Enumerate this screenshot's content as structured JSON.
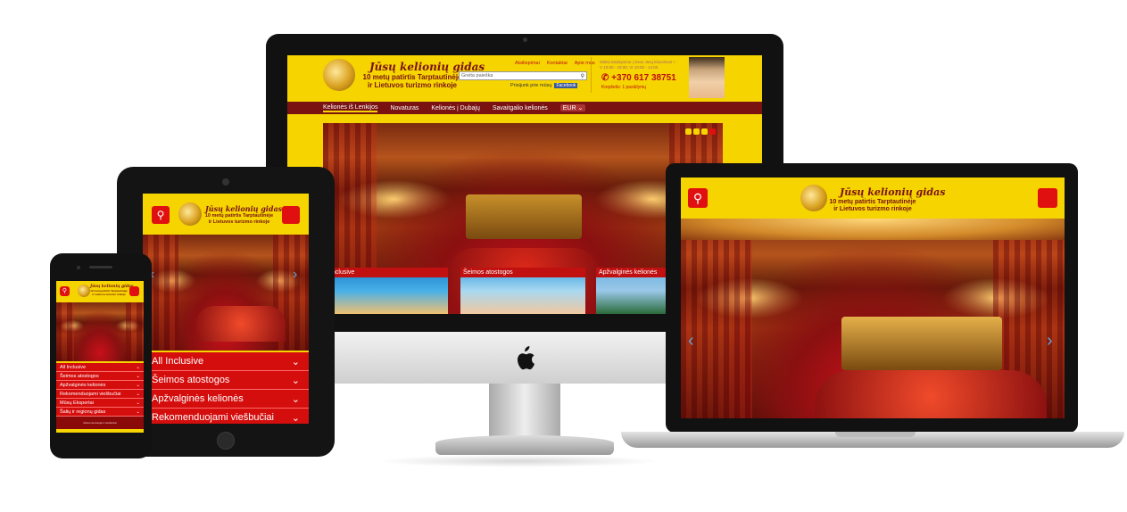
{
  "brand": {
    "title": "Jūsų kelionių gidas",
    "subtitle_line1": "10 metų patirtis Tarptautinėje",
    "subtitle_line2": "ir Lietuvos turizmo rinkoje"
  },
  "desktop": {
    "search_placeholder": "Greita paieška",
    "top_links": [
      "Atsiliepimai",
      "Kontaktai",
      "Apie mus"
    ],
    "follow_text": "Prisijunk prie mūsų",
    "fb_label": "Facebook",
    "hours_line1": "Mielai atsakysime į visus Jūsų klausimus I -",
    "hours_line2": "V 10:00 - 19:00, VI 10:00 - 14:00",
    "phone": "+370 617 38751",
    "callback": "Krepšelis: 1 pasiūlymų",
    "nav": [
      "Kelionės iš Lenkijos",
      "Novaturas",
      "Kelionės į Dubajų",
      "Savaitgalio kelionės"
    ],
    "currency": "EUR",
    "tiles": [
      "ll Inclusive",
      "Šeimos atostogos",
      "Apžvalginės kelionės"
    ]
  },
  "tablet": {
    "menu": [
      "All Inclusive",
      "Šeimos atostogos",
      "Apžvalginės kelionės",
      "Rekomenduojami viešbučiai"
    ]
  },
  "phone": {
    "menu": [
      "All Inclusive",
      "Šeimos atostogos",
      "Apžvalginės kelionės",
      "Rekomenduojami viešbučiai",
      "Mūsų Ekspertai",
      "Šalių ir regionų gidas"
    ],
    "footer_text": "Rekomenduojami viešbučiai"
  },
  "colors": {
    "accent_yellow": "#f5d400",
    "accent_red": "#d40d0d",
    "nav_dark_red": "#7a1212"
  }
}
